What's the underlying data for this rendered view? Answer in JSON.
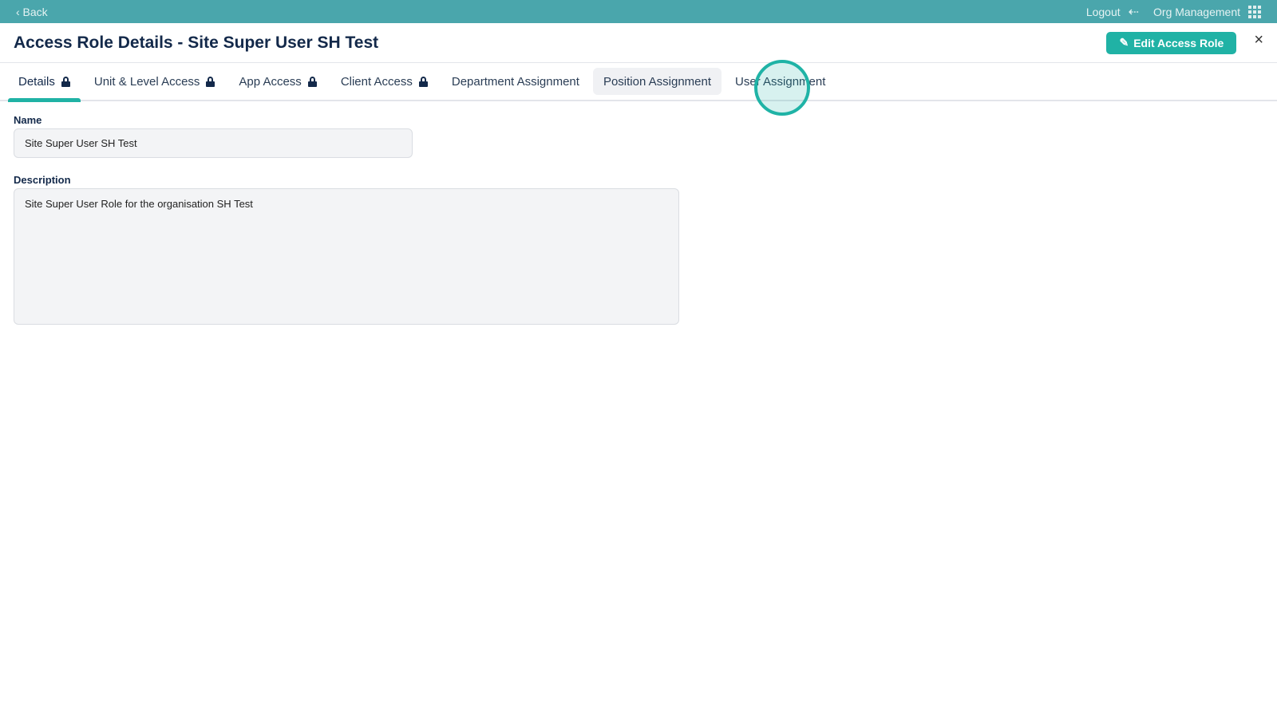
{
  "topbar": {
    "back": "‹ Back",
    "logout": "Logout",
    "org": "Org Management"
  },
  "header": {
    "title": "Access Role Details - Site Super User SH Test",
    "edit_button": "Edit Access Role",
    "close": "×"
  },
  "tabs": [
    {
      "label": "Details",
      "locked": true
    },
    {
      "label": "Unit & Level Access",
      "locked": true
    },
    {
      "label": "App Access",
      "locked": true
    },
    {
      "label": "Client Access",
      "locked": true
    },
    {
      "label": "Department Assignment",
      "locked": false
    },
    {
      "label": "Position Assignment",
      "locked": false
    },
    {
      "label": "User Assignment",
      "locked": false
    }
  ],
  "form": {
    "name_label": "Name",
    "name_value": "Site Super User SH Test",
    "description_label": "Description",
    "description_value": "Site Super User Role for the organisation SH Test"
  }
}
